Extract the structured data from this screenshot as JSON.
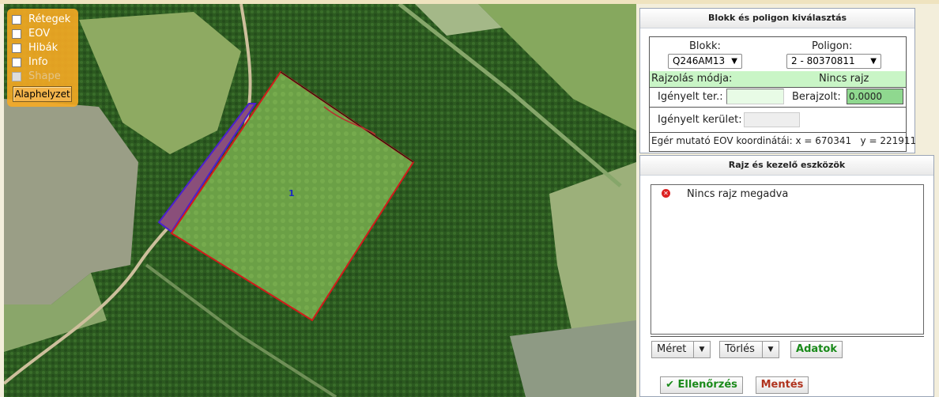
{
  "layers": {
    "items": [
      {
        "label": "Rétegek",
        "enabled": true
      },
      {
        "label": "EOV",
        "enabled": true
      },
      {
        "label": "Hibák",
        "enabled": true
      },
      {
        "label": "Info",
        "enabled": true
      },
      {
        "label": "Shape",
        "enabled": false
      }
    ],
    "reset_label": "Alaphelyzet"
  },
  "map": {
    "polygon_label": "1"
  },
  "selection_panel": {
    "title": "Blokk és poligon kiválasztás",
    "blokk_label": "Blokk:",
    "blokk_value": "Q246AM13",
    "poligon_label": "Poligon:",
    "poligon_value": "2 - 80370811",
    "drawing_mode_label": "Rajzolás módja:",
    "drawing_mode_value": "Nincs rajz",
    "requested_area_label": "Igényelt ter.:",
    "requested_area_value": "",
    "drawn_label": "Berajzolt:",
    "drawn_value": "0.0000",
    "requested_perimeter_label": "Igényelt kerület:",
    "requested_perimeter_value": "",
    "coords_label": "Egér mutató EOV koordinátái:",
    "coord_x": "x = 670341",
    "coord_y": "y = 221911"
  },
  "tools_panel": {
    "title": "Rajz és kezelő eszközök",
    "message": "Nincs rajz megadva",
    "size_label": "Méret",
    "delete_label": "Törlés",
    "data_label": "Adatok",
    "check_label": "Ellenőrzés",
    "save_label": "Mentés"
  },
  "colors": {
    "layer_box": "#f6aa23",
    "green_row": "#c9f5c6",
    "drawn_field": "#8fd88f",
    "polygon_outline": "#d21a1a"
  }
}
